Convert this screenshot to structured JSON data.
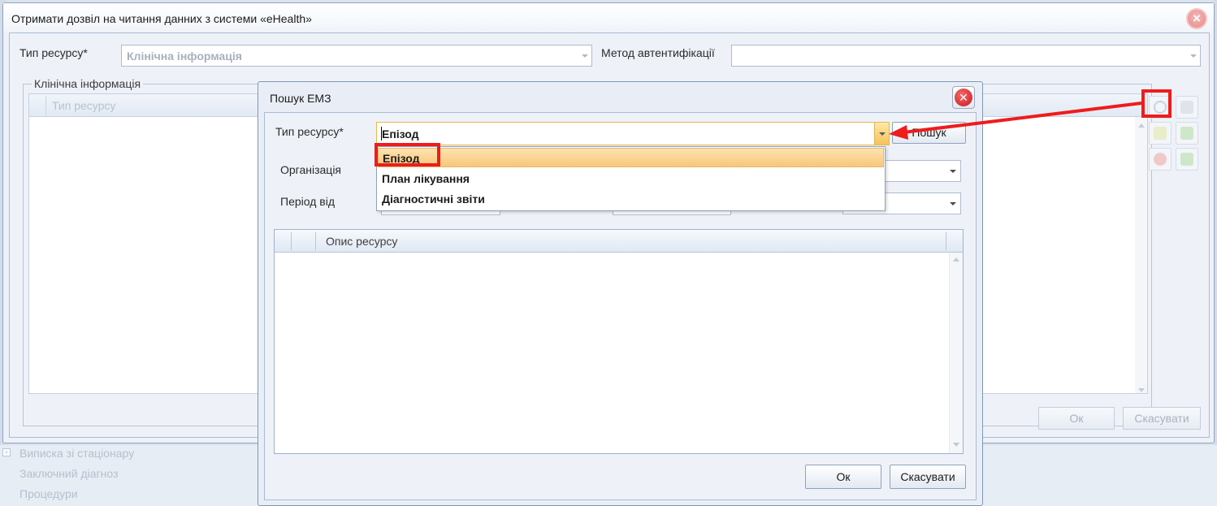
{
  "main_dialog": {
    "title": "Отримати дозвіл на читання данних з системи «eHealth»",
    "resource_type_label": "Тип ресурсу*",
    "resource_type_value": "Клінічна інформація",
    "auth_method_label": "Метод автентифікації",
    "auth_method_value": "",
    "group_title": "Клінічна інформація",
    "grid_header": "Тип ресурсу",
    "ok_label": "Ок",
    "cancel_label": "Скасувати"
  },
  "background_tree": {
    "items": [
      "Виписка зі стаціонару",
      "Заключний діагноз",
      "Процедури"
    ]
  },
  "search_modal": {
    "title": "Пошук ЕМЗ",
    "resource_type_label": "Тип ресурсу*",
    "resource_type_value": "Епізод",
    "search_button": "Пошук",
    "organization_label": "Організація",
    "period_label": "Період від",
    "dropdown_options": [
      "Епізод",
      "План лікування",
      "Діагностичні звіти"
    ],
    "selected_option": "Епізод",
    "grid_header": "Опис ресурсу",
    "ok_label": "Ок",
    "cancel_label": "Скасувати"
  },
  "colors": {
    "annotation_red": "#ee1c1c",
    "selection_orange": "#f7c77b",
    "frame_blue": "#7f97b8"
  }
}
